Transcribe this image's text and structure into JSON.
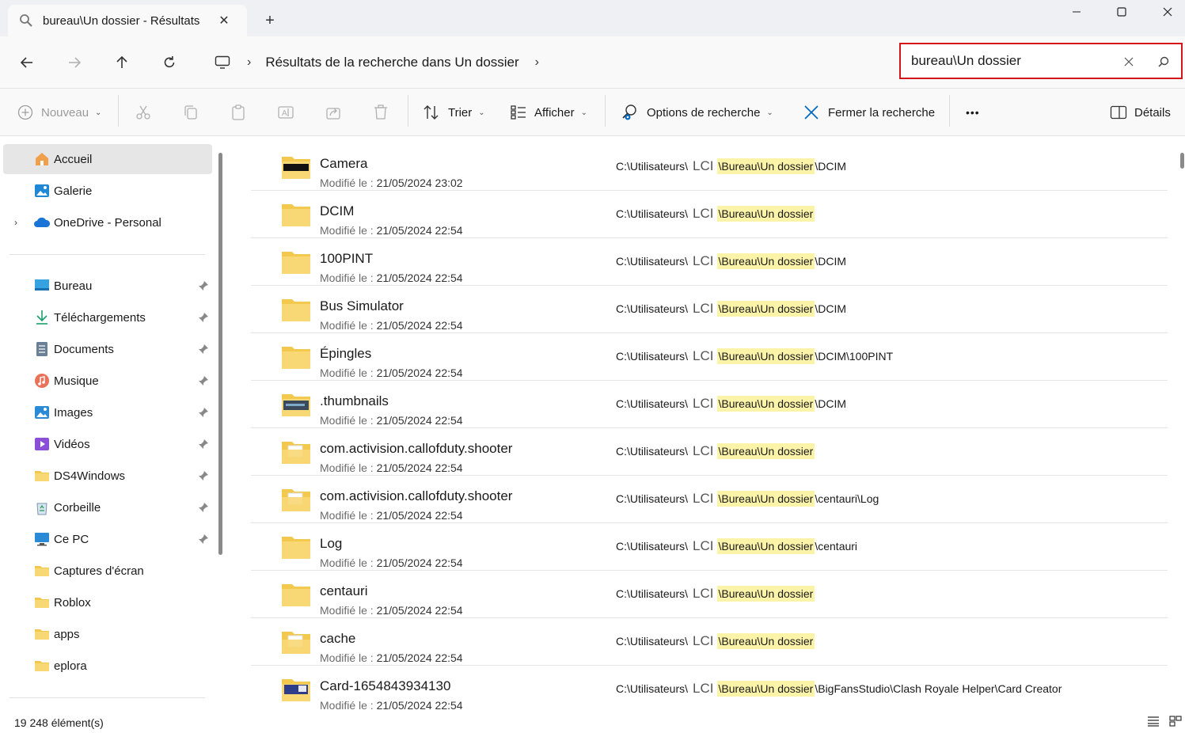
{
  "window": {
    "tab_title": "bureau\\Un dossier - Résultats",
    "tab_close": "✕",
    "new_tab": "+"
  },
  "address": {
    "separator": "›",
    "breadcrumb": "Résultats de la recherche dans Un dossier",
    "trailing_separator": "›"
  },
  "search": {
    "value": "bureau\\Un dossier"
  },
  "commands": {
    "new": "Nouveau",
    "sort": "Trier",
    "view": "Afficher",
    "search_options": "Options de recherche",
    "close_search": "Fermer la recherche",
    "more": "•••",
    "details": "Détails"
  },
  "sidebar": {
    "home": "Accueil",
    "gallery": "Galerie",
    "onedrive": "OneDrive - Personal",
    "pinned": [
      {
        "label": "Bureau",
        "icon": "desktop-icon"
      },
      {
        "label": "Téléchargements",
        "icon": "download-icon"
      },
      {
        "label": "Documents",
        "icon": "documents-icon"
      },
      {
        "label": "Musique",
        "icon": "music-icon"
      },
      {
        "label": "Images",
        "icon": "pictures-icon"
      },
      {
        "label": "Vidéos",
        "icon": "videos-icon"
      },
      {
        "label": "DS4Windows",
        "icon": "folder-icon"
      },
      {
        "label": "Corbeille",
        "icon": "recycle-bin-icon"
      },
      {
        "label": "Ce PC",
        "icon": "computer-icon"
      }
    ],
    "folders": [
      {
        "label": "Captures d'écran"
      },
      {
        "label": "Roblox"
      },
      {
        "label": "apps"
      },
      {
        "label": "eplora"
      }
    ]
  },
  "results": {
    "modified_label": "Modifié le :",
    "path_prefix": "C:\\Utilisateurs\\",
    "lci": "LCI",
    "path_match": "\\Bureau\\Un dossier",
    "items": [
      {
        "name": "Camera",
        "date": "21/05/2024 23:02",
        "suffix": "\\DCIM",
        "thumb": "camera"
      },
      {
        "name": "DCIM",
        "date": "21/05/2024 22:54",
        "suffix": "",
        "thumb": "plain"
      },
      {
        "name": "100PINT",
        "date": "21/05/2024 22:54",
        "suffix": "\\DCIM",
        "thumb": "plain"
      },
      {
        "name": "Bus Simulator",
        "date": "21/05/2024 22:54",
        "suffix": "\\DCIM",
        "thumb": "plain"
      },
      {
        "name": "Épingles",
        "date": "21/05/2024 22:54",
        "suffix": "\\DCIM\\100PINT",
        "thumb": "plain"
      },
      {
        "name": ".thumbnails",
        "date": "21/05/2024 22:54",
        "suffix": "\\DCIM",
        "thumb": "thumbs"
      },
      {
        "name": "com.activision.callofduty.shooter",
        "date": "21/05/2024 22:54",
        "suffix": "",
        "thumb": "doc"
      },
      {
        "name": "com.activision.callofduty.shooter",
        "date": "21/05/2024 22:54",
        "suffix": "\\centauri\\Log",
        "thumb": "doc"
      },
      {
        "name": "Log",
        "date": "21/05/2024 22:54",
        "suffix": "\\centauri",
        "thumb": "plain"
      },
      {
        "name": "centauri",
        "date": "21/05/2024 22:54",
        "suffix": "",
        "thumb": "plain"
      },
      {
        "name": "cache",
        "date": "21/05/2024 22:54",
        "suffix": "",
        "thumb": "doc"
      },
      {
        "name": "Card-1654843934130",
        "date": "21/05/2024 22:54",
        "suffix": "\\BigFansStudio\\Clash Royale Helper\\Card Creator",
        "thumb": "card"
      }
    ]
  },
  "status": {
    "count": "19 248 élément(s)"
  },
  "colors": {
    "accent": "#0067c0",
    "highlight": "#fbf3a8",
    "search_border": "#d4161b",
    "folder": "#f8d775"
  }
}
